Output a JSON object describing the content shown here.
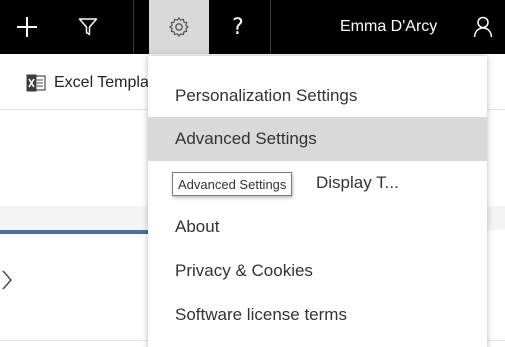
{
  "topbar": {
    "new_icon": "plus-icon",
    "filter_icon": "filter-icon",
    "settings_icon": "gear-icon",
    "help_label": "?",
    "user_name": "Emma D'Arcy",
    "user_icon": "person-icon"
  },
  "commandbar": {
    "excel_icon": "excel-icon",
    "excel_label": "Excel Templa"
  },
  "menu": {
    "items": [
      {
        "label": "Personalization Settings"
      },
      {
        "label": "Advanced Settings"
      },
      {
        "label": "Display T..."
      },
      {
        "label": "About"
      },
      {
        "label": "Privacy & Cookies"
      },
      {
        "label": "Software license terms"
      }
    ],
    "tooltip": "Advanced Settings"
  },
  "colors": {
    "topbar_bg": "#000000",
    "active_bg": "#d9d9d9",
    "menu_hover_bg": "#d9d9d9",
    "accent": "#4a6fa5",
    "excel_green": "#217346"
  }
}
